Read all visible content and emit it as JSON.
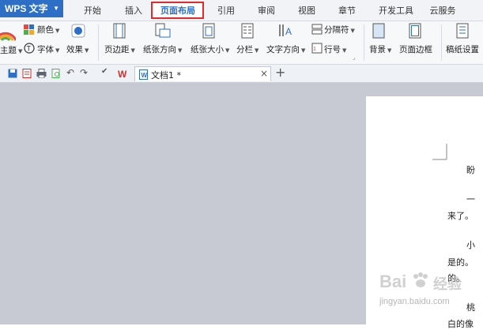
{
  "app": {
    "name": "WPS 文字"
  },
  "menu": {
    "tabs": [
      "开始",
      "插入",
      "页面布局",
      "引用",
      "审阅",
      "视图",
      "章节",
      "开发工具",
      "云服务"
    ],
    "active": "页面布局"
  },
  "ribbon": {
    "theme": "主题",
    "color": "颜色",
    "font": "字体",
    "effect": "效果",
    "margins": "页边距",
    "orientation": "纸张方向",
    "size": "纸张大小",
    "columns": "分栏",
    "text_direction": "文字方向",
    "breaks": "分隔符",
    "line_numbers": "行号",
    "background": "背景",
    "page_border": "页面边框",
    "manuscript": "稿纸设置"
  },
  "document_tab": {
    "title": "文档1 *"
  },
  "page_text": {
    "line1": "盼",
    "line2": "一",
    "line3": "来了。",
    "line4": "小",
    "line5": "是的。",
    "line6": "的。",
    "line7": "桃",
    "line8": "白的像"
  },
  "watermark": {
    "brand": "Bai",
    "brand2": "经验",
    "url": "jingyan.baidu.com"
  },
  "colors": {
    "accent": "#2d6fc7",
    "highlight": "#e8282b",
    "wps_red": "#d22d2d"
  }
}
